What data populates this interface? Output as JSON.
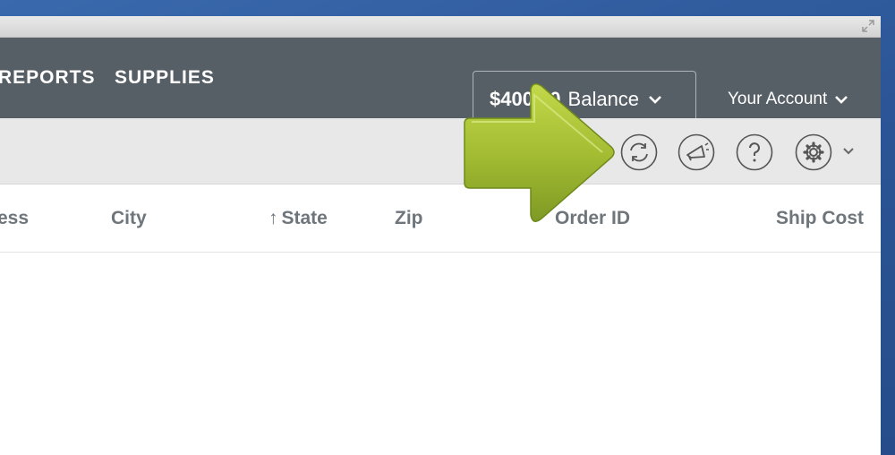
{
  "nav": {
    "items": [
      {
        "label": "REPORTS"
      },
      {
        "label": "SUPPLIES"
      }
    ],
    "balance": {
      "amount": "$400.00",
      "label": "Balance"
    },
    "account_label": "Your Account"
  },
  "toolbar": {
    "buttons": [
      "refresh-icon",
      "megaphone-icon",
      "help-icon",
      "settings-icon"
    ]
  },
  "table": {
    "columns": [
      "ess",
      "City",
      "State",
      "Zip",
      "Order ID",
      "Ship Cost"
    ],
    "sort_arrow": "↑"
  },
  "colors": {
    "nav_bg": "#575f66",
    "toolbar_bg": "#e8e8e8",
    "accent_arrow": "#a4bd33",
    "backdrop": "#2d5a9c"
  }
}
